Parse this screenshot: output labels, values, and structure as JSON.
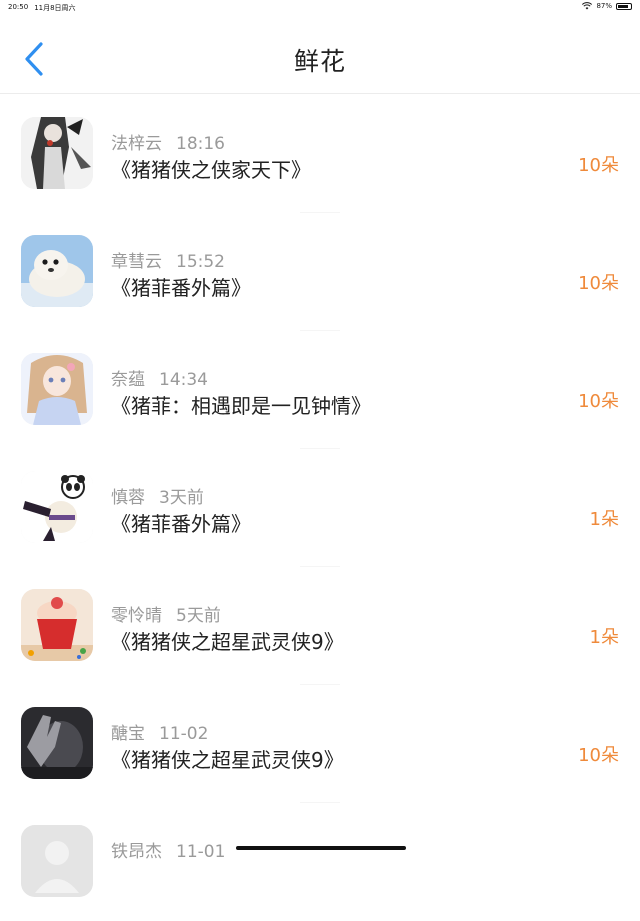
{
  "status_bar": {
    "time": "20:50",
    "date": "11月8日周六",
    "battery": "87%",
    "battery_level": 0.87
  },
  "nav": {
    "title": "鲜花"
  },
  "items": [
    {
      "name": "法梓云",
      "time": "18:16",
      "title": "《猪猪侠之侠家天下》",
      "count": "10朵",
      "avatar": "avatar-anime-girl-bw"
    },
    {
      "name": "章彗云",
      "time": "15:52",
      "title": "《猪菲番外篇》",
      "count": "10朵",
      "avatar": "avatar-seal"
    },
    {
      "name": "奈蕴",
      "time": "14:34",
      "title": "《猪菲：相遇即是一见钟情》",
      "count": "10朵",
      "avatar": "avatar-anime-girl-color"
    },
    {
      "name": "慎蓉",
      "time": "3天前",
      "title": "《猪菲番外篇》",
      "count": "1朵",
      "avatar": "avatar-panda"
    },
    {
      "name": "零怜晴",
      "time": "5天前",
      "title": "《猪猪侠之超星武灵侠9》",
      "count": "1朵",
      "avatar": "avatar-cupcake"
    },
    {
      "name": "醣宝",
      "time": "11-02",
      "title": "《猪猪侠之超星武灵侠9》",
      "count": "10朵",
      "avatar": "avatar-dark-photo"
    },
    {
      "name": "铁昂杰",
      "time": "11-01",
      "title": "",
      "count": "",
      "avatar": "avatar-default"
    }
  ],
  "colors": {
    "accent_blue": "#2f8ff0",
    "count_orange": "#ef8a3b",
    "meta_gray": "#9a9a9a"
  }
}
